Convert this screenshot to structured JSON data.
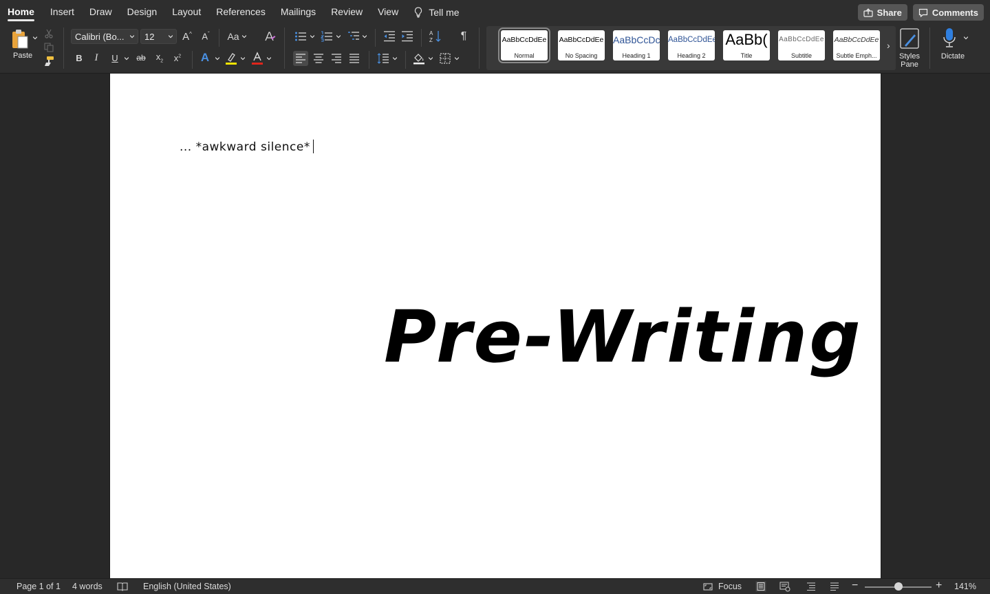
{
  "tabs": [
    "Home",
    "Insert",
    "Draw",
    "Design",
    "Layout",
    "References",
    "Mailings",
    "Review",
    "View"
  ],
  "tell_me": "Tell me",
  "share_label": "Share",
  "comments_label": "Comments",
  "clipboard": {
    "paste_label": "Paste"
  },
  "font": {
    "name": "Calibri (Bo...",
    "size": "12"
  },
  "styles": [
    {
      "preview": "AaBbCcDdEe",
      "name": "Normal"
    },
    {
      "preview": "AaBbCcDdEe",
      "name": "No Spacing"
    },
    {
      "preview": "AaBbCcDc",
      "name": "Heading 1"
    },
    {
      "preview": "AaBbCcDdEe",
      "name": "Heading 2"
    },
    {
      "preview": "AaBb(",
      "name": "Title"
    },
    {
      "preview": "AaBbCcDdEe",
      "name": "Subtitle"
    },
    {
      "preview": "AaBbCcDdEe",
      "name": "Subtle Emph..."
    }
  ],
  "styles_pane": {
    "line1": "Styles",
    "line2": "Pane"
  },
  "dictate_label": "Dictate",
  "document": {
    "line1": "... *awkward silence*",
    "heading": "Pre-Writing"
  },
  "status": {
    "page": "Page 1 of 1",
    "words": "4 words",
    "language": "English (United States)",
    "focus": "Focus",
    "zoom": "141%",
    "zoom_level": 0.5
  },
  "colors": {
    "highlight": "#f5e400",
    "font_color": "#e0251b",
    "accent_blue": "#4a90e2"
  }
}
